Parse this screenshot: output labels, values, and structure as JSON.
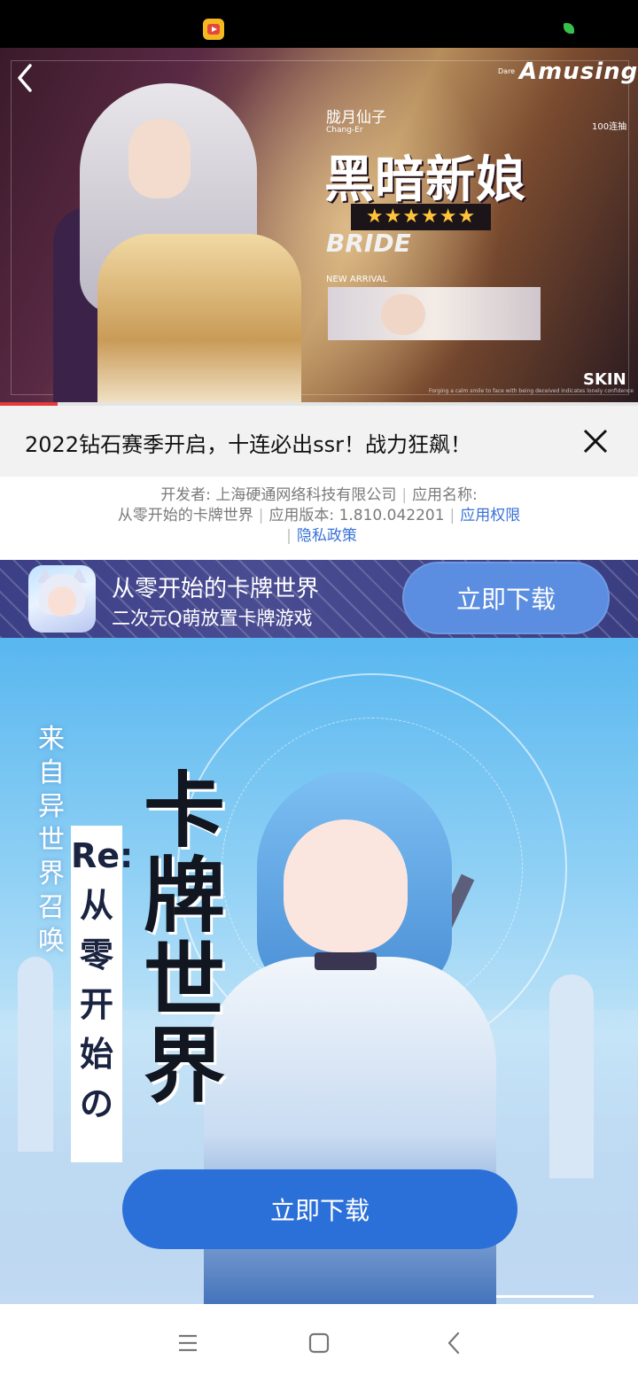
{
  "status_bar": {
    "app_icon": "video-app-icon",
    "right_icon": "leaf-icon"
  },
  "banner": {
    "back_icon": "chevron-left-icon",
    "character_name": "胧月仙子",
    "character_name_en": "Chang-Er",
    "title": "黑暗新娘",
    "stars": "★★★★★★",
    "subtitle": "BRIDE",
    "arrival": "NEW ARRIVAL",
    "brand": "Amusing",
    "brand_small": "Dare",
    "side_note": "100连抽",
    "skin_label": "SKIN",
    "caption": "Forging a calm smile to face with being deceived indicates lonely confidence",
    "progress_fraction": 0.09
  },
  "ad": {
    "headline": "2022钻石赛季开启，十连必出ssr！战力狂飙！",
    "close_icon": "close-icon"
  },
  "dev_info": {
    "developer": "开发者: 上海硬通网络科技有限公司",
    "app_name_label": "应用名称:",
    "app_name": "从零开始的卡牌世界",
    "version": "应用版本: 1.810.042201",
    "permissions_link": "应用权限",
    "privacy_link": "隐私政策",
    "separator": "|"
  },
  "app_bar": {
    "name": "从零开始的卡牌世界",
    "tagline": "二次元Q萌放置卡牌游戏",
    "download_label": "立即下载",
    "icon": "game-app-icon"
  },
  "poster": {
    "side_text": "来自异世界召唤",
    "title": "卡牌世界",
    "subtitle": "Re:从零开始の",
    "download_label": "立即下载"
  },
  "nav_bar": {
    "menu_icon": "menu-icon",
    "home_icon": "home-square-icon",
    "back_icon": "back-triangle-icon"
  },
  "colors": {
    "accent_blue": "#2b6fd8",
    "link_blue": "#3a72d8",
    "app_bar_bg": "#3f4287",
    "progress_red": "#e33a3a"
  }
}
